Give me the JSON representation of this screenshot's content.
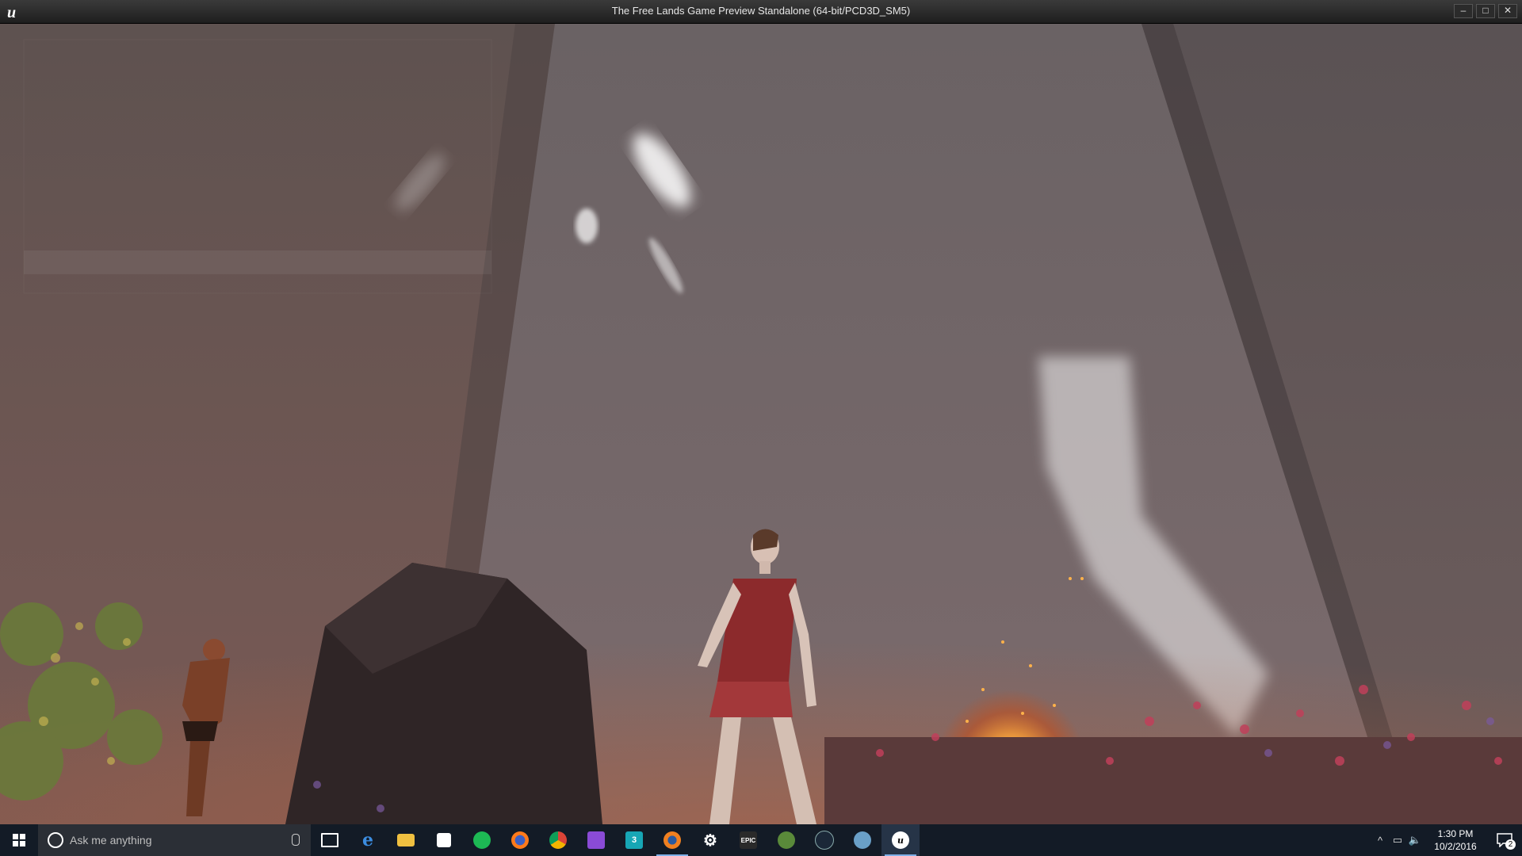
{
  "window": {
    "title": "The Free Lands Game Preview Standalone (64-bit/PCD3D_SM5)",
    "app_icon": "unreal-engine-icon",
    "controls": {
      "minimize": "–",
      "maximize": "□",
      "close": "✕"
    }
  },
  "taskbar": {
    "start_icon": "windows-start-icon",
    "search_placeholder": "Ask me anything",
    "pinned": [
      {
        "name": "task-view-icon",
        "label": ""
      },
      {
        "name": "edge-icon",
        "label": "e"
      },
      {
        "name": "file-explorer-icon",
        "label": ""
      },
      {
        "name": "store-icon",
        "label": ""
      },
      {
        "name": "spotify-icon",
        "label": ""
      },
      {
        "name": "firefox-icon",
        "label": ""
      },
      {
        "name": "chrome-icon",
        "label": ""
      },
      {
        "name": "visual-studio-icon",
        "label": ""
      },
      {
        "name": "3ds-max-icon",
        "label": "3"
      },
      {
        "name": "blender-icon",
        "label": ""
      },
      {
        "name": "settings-icon",
        "label": "⚙"
      },
      {
        "name": "epic-games-icon",
        "label": "EPIC"
      },
      {
        "name": "speedtree-icon",
        "label": ""
      },
      {
        "name": "steam-icon",
        "label": ""
      },
      {
        "name": "app-icon",
        "label": ""
      },
      {
        "name": "unreal-engine-icon",
        "label": "u"
      }
    ],
    "tray": {
      "chevron": "^",
      "time": "1:30 PM",
      "date": "10/2/2016",
      "notification_count": "2"
    }
  },
  "colors": {
    "taskbar_bg": "#131b26",
    "titlebar_bg": "#2a2a2a",
    "active_indicator": "#7fb0e8"
  }
}
